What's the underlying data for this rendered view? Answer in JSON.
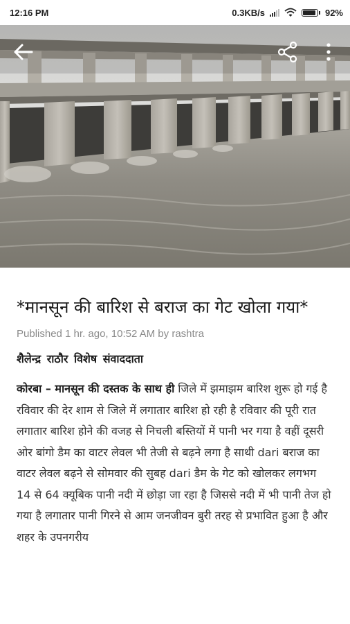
{
  "status_bar": {
    "time": "12:16 PM",
    "network_speed": "0.3KB/s",
    "battery": "92%",
    "icons": [
      "signal-icon",
      "wifi-icon",
      "battery-icon"
    ]
  },
  "toolbar": {
    "back_icon": "back-arrow-icon",
    "share_icon": "share-icon",
    "more_icon": "more-vertical-icon"
  },
  "article": {
    "headline": "*मानसून की बारिश से बराज का गेट खोला गया*",
    "published": "Published 1 hr. ago, 10:52 AM by rashtra",
    "byline": "शैलेन्द्र राठौर  विशेष संवाददाता",
    "lead": "कोरबा – मानसून की दस्तक के साथ ही",
    "body": " जिले में झमाझम बारिश शुरू हो गई है रविवार की देर शाम से जिले में लगातार बारिश हो रही है रविवार की पूरी रात लगातार बारिश होने की वजह से निचली बस्तियों में पानी भर गया है वहीं दूसरी ओर बांगो डैम का वाटर लेवल भी तेजी से बढ़ने लगा है साथी dari बराज का वाटर लेवल बढ़ने से सोमवार की सुबह dari डैम के गेट को खोलकर लगभग 14 से 64 क्यूबिक पानी नदी में छोड़ा जा रहा है जिससे नदी में भी पानी तेज हो गया है लगातार पानी गिरने से आम जनजीवन बुरी तरह से प्रभावित हुआ है और शहर के उपनगरीय"
  },
  "colors": {
    "water": "#9a978f",
    "concrete": "#b9b5ad",
    "sky": "#d6d6d4",
    "meta_text": "#8a8a8a"
  }
}
